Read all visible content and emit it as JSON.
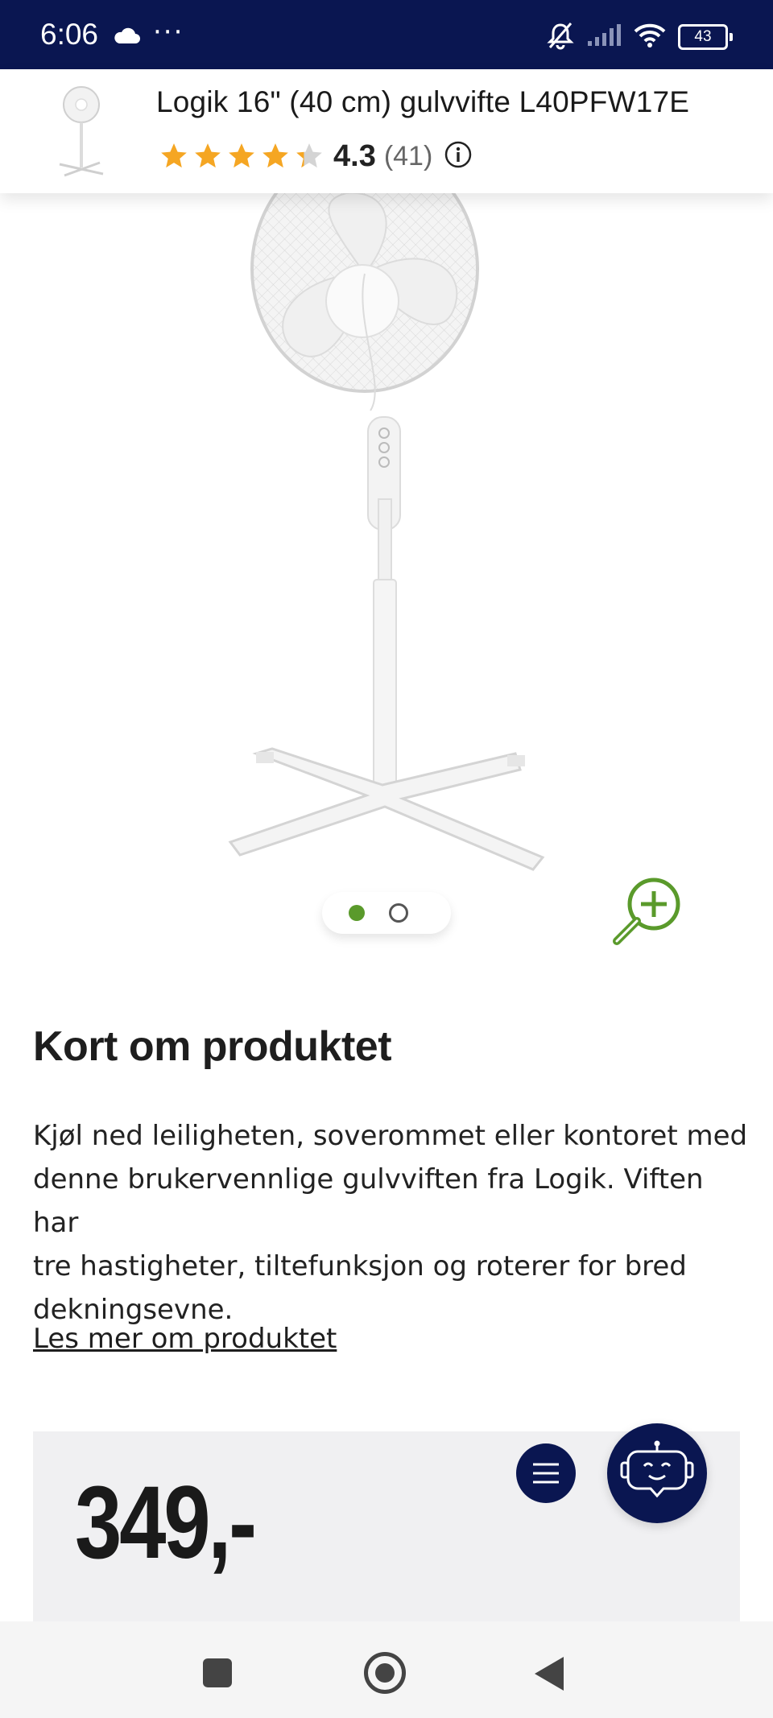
{
  "status_bar": {
    "time": "6:06",
    "dots": "···",
    "battery": "43",
    "icons": [
      "cloud-icon",
      "mute-icon",
      "signal-icon",
      "wifi-icon",
      "battery-icon"
    ]
  },
  "product_header": {
    "title": "Logik 16\" (40 cm) gulvvifte L40PFW17E",
    "rating": {
      "stars": 4.3,
      "value": "4.3",
      "count": "(41)"
    }
  },
  "carousel": {
    "total": 2,
    "active_index": 0
  },
  "about": {
    "title": "Kort om produktet",
    "lines": [
      "Kjøl ned leiligheten, soverommet eller kontoret med",
      "denne brukervennlige gulvviften fra Logik. Viften har",
      "tre hastigheter, tiltefunksjon og roterer for bred",
      "dekningsevne."
    ],
    "read_more": "Les mer om produktet"
  },
  "price": {
    "value": "349,-"
  },
  "colors": {
    "brand_navy": "#0a1651",
    "star": "#f5a623",
    "accent_green": "#5a9a2b"
  }
}
